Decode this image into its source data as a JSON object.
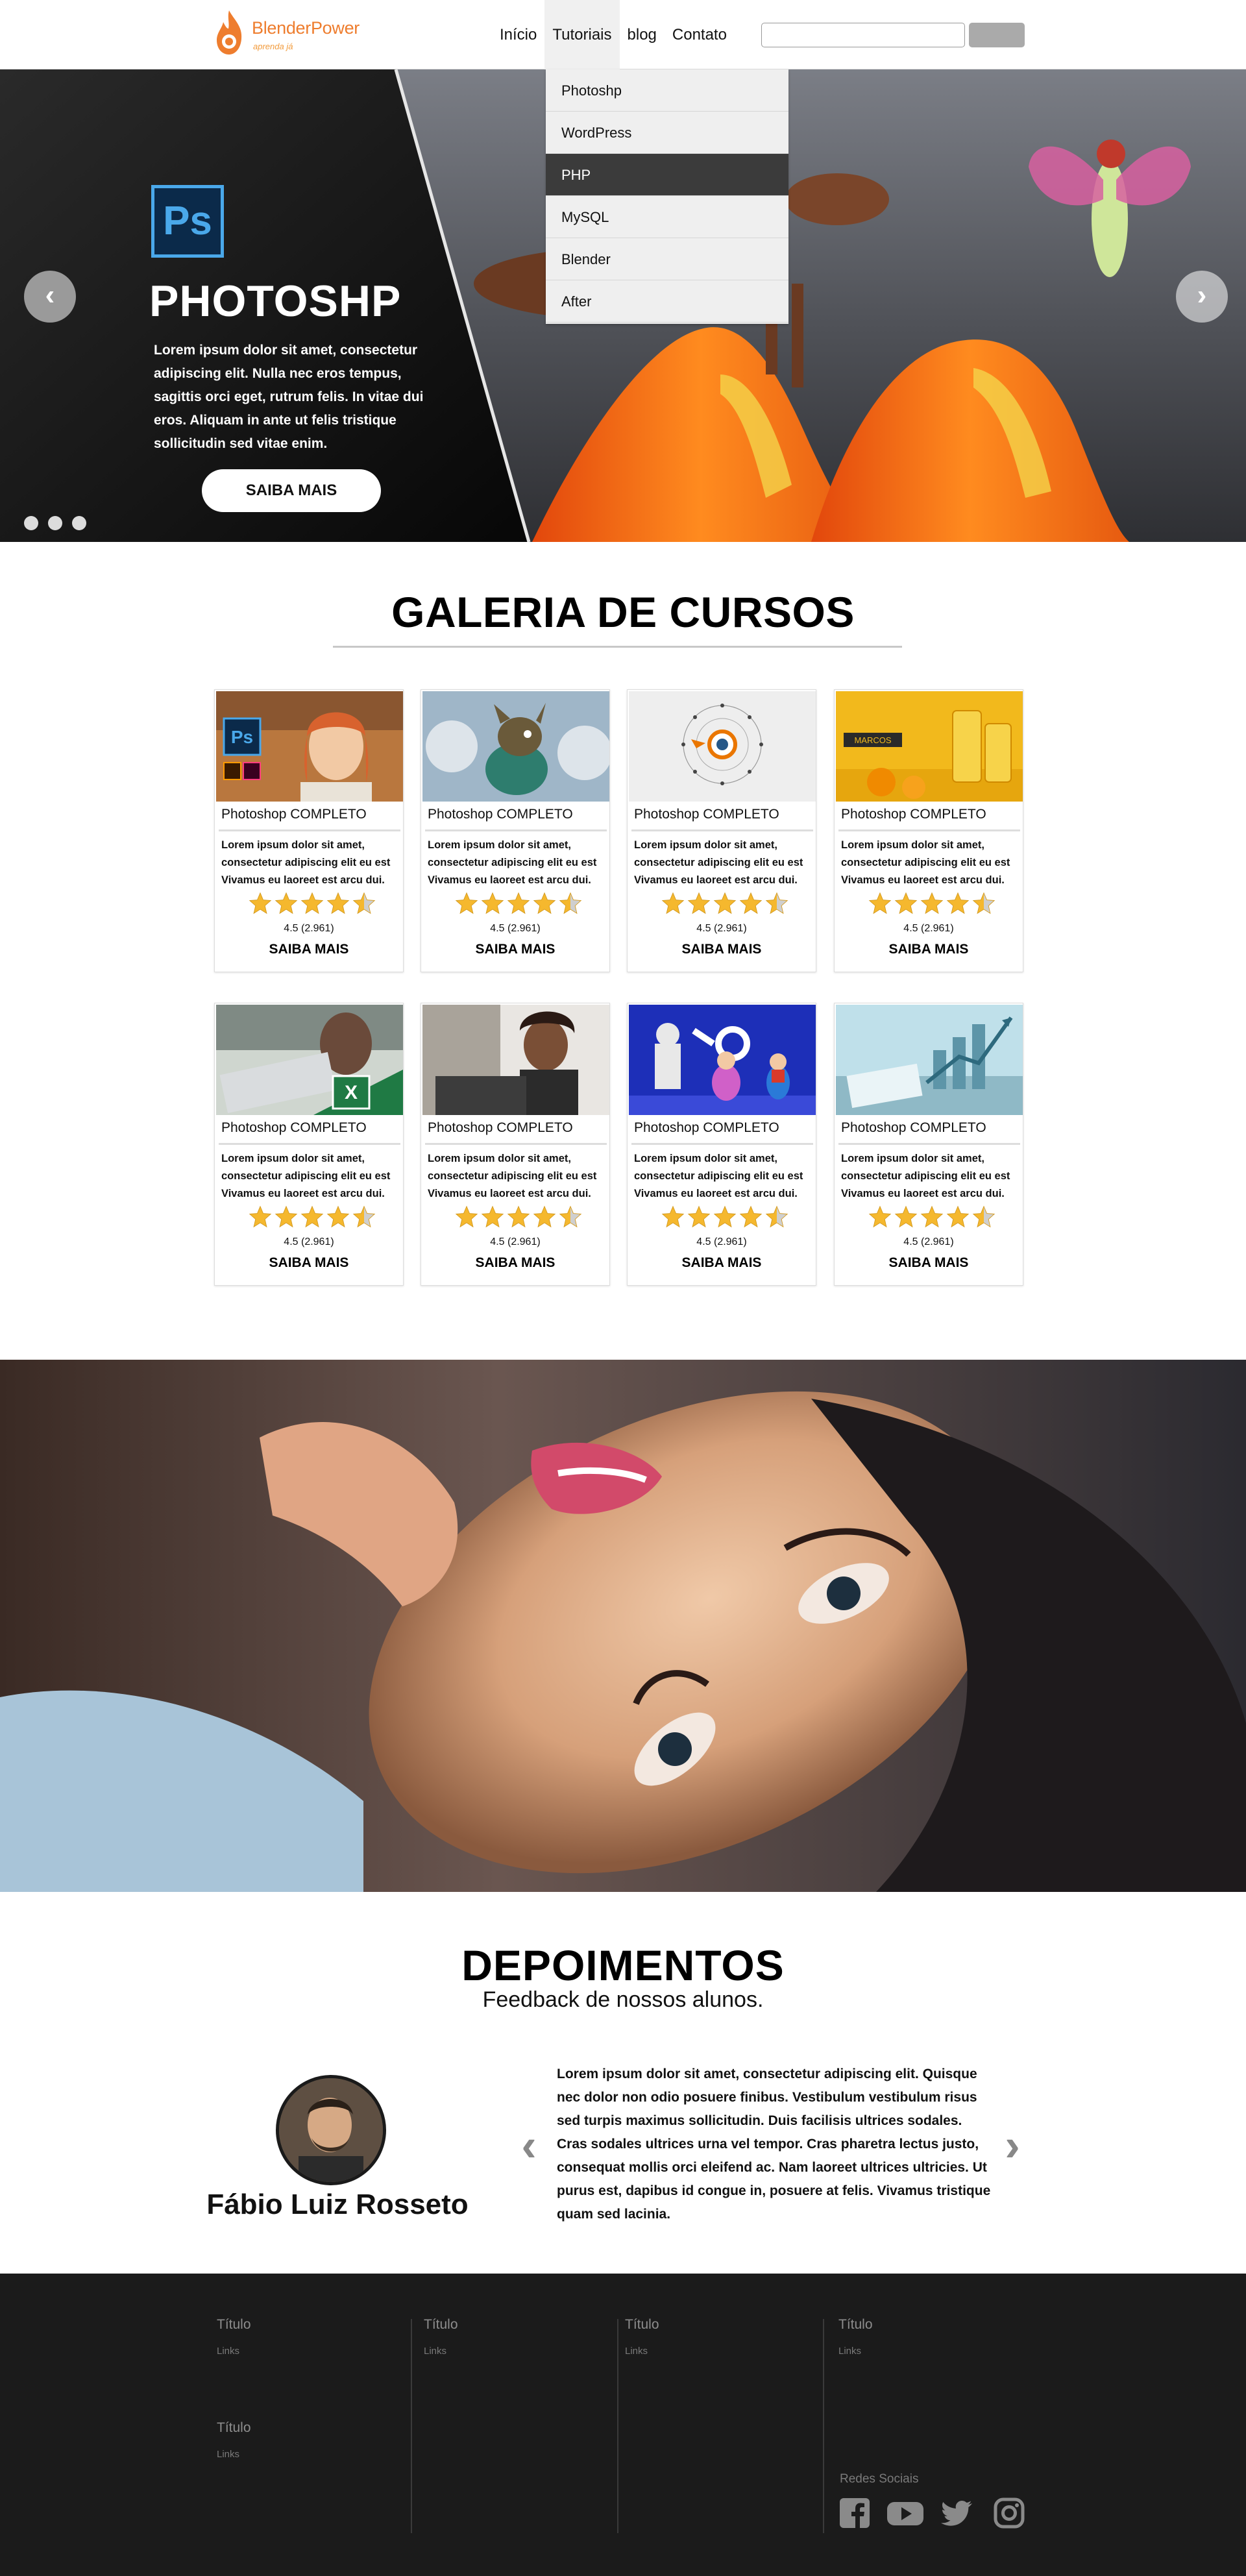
{
  "header": {
    "logo_name": "BlenderPower",
    "logo_tagline": "aprenda já",
    "nav": [
      "Início",
      "Tutoriais",
      "blog",
      "Contato"
    ],
    "search_placeholder": ""
  },
  "dropdown": {
    "items": [
      "Photoshp",
      "WordPress",
      "PHP",
      "MySQL",
      "Blender",
      "After"
    ],
    "highlighted": "PHP"
  },
  "hero": {
    "logo_text": "Ps",
    "title": "PHOTOSHP",
    "text": "Lorem ipsum dolor sit amet, consectetur adipiscing elit. Nulla nec eros tempus, sagittis orci eget, rutrum felis. In vitae dui eros. Aliquam in ante ut felis tristique sollicitudin sed vitae enim.",
    "cta": "SAIBA MAIS",
    "arrow_left": "‹",
    "arrow_right": "›",
    "slide_count": 3
  },
  "gallery": {
    "title": "GALERIA DE CURSOS",
    "cards": [
      {
        "title": "Photoshop COMPLETO",
        "desc": "Lorem ipsum dolor sit amet, consectetur adipiscing elit eu est Vivamus eu laoreet est arcu dui.",
        "rating": "4.5 (2.961)",
        "link": "SAIBA MAIS",
        "stars": 4.5,
        "image": "photoshop-woman"
      },
      {
        "title": "Photoshop COMPLETO",
        "desc": "Lorem ipsum dolor sit amet, consectetur adipiscing elit eu est Vivamus eu laoreet est arcu dui.",
        "rating": "4.5 (2.961)",
        "link": "SAIBA MAIS",
        "stars": 4.5,
        "image": "3d-creature"
      },
      {
        "title": "Photoshop COMPLETO",
        "desc": "Lorem ipsum dolor sit amet, consectetur adipiscing elit eu est Vivamus eu laoreet est arcu dui.",
        "rating": "4.5 (2.961)",
        "link": "SAIBA MAIS",
        "stars": 4.5,
        "image": "blender-logo"
      },
      {
        "title": "Photoshop COMPLETO",
        "desc": "Lorem ipsum dolor sit amet, consectetur adipiscing elit eu est Vivamus eu laoreet est arcu dui.",
        "rating": "4.5 (2.961)",
        "link": "SAIBA MAIS",
        "stars": 4.5,
        "image": "orange-juice-ad"
      },
      {
        "title": "Photoshop COMPLETO",
        "desc": "Lorem ipsum dolor sit amet, consectetur adipiscing elit eu est Vivamus eu laoreet est arcu dui.",
        "rating": "4.5 (2.961)",
        "link": "SAIBA MAIS",
        "stars": 4.5,
        "image": "excel-laptop"
      },
      {
        "title": "Photoshop COMPLETO",
        "desc": "Lorem ipsum dolor sit amet, consectetur adipiscing elit eu est Vivamus eu laoreet est arcu dui.",
        "rating": "4.5 (2.961)",
        "link": "SAIBA MAIS",
        "stars": 4.5,
        "image": "woman-laptop"
      },
      {
        "title": "Photoshop COMPLETO",
        "desc": "Lorem ipsum dolor sit amet, consectetur adipiscing elit eu est Vivamus eu laoreet est arcu dui.",
        "rating": "4.5 (2.961)",
        "link": "SAIBA MAIS",
        "stars": 4.5,
        "image": "blender-characters"
      },
      {
        "title": "Photoshop COMPLETO",
        "desc": "Lorem ipsum dolor sit amet, consectetur adipiscing elit eu est Vivamus eu laoreet est arcu dui.",
        "rating": "4.5 (2.961)",
        "link": "SAIBA MAIS",
        "stars": 4.5,
        "image": "business-chart"
      }
    ]
  },
  "testimonials": {
    "title": "DEPOIMENTOS",
    "subtitle": "Feedback de nossos alunos.",
    "author": "Fábio Luiz Rosseto",
    "text": "Lorem ipsum dolor sit amet, consectetur adipiscing elit. Quisque nec dolor non odio posuere finibus. Vestibulum vestibulum risus sed turpis maximus sollicitudin. Duis facilisis ultrices sodales. Cras sodales ultrices urna vel tempor. Cras pharetra lectus justo, consequat mollis orci eleifend ac. Nam laoreet ultrices ultricies. Ut purus est, dapibus id congue in, posuere at felis. Vivamus tristique quam sed lacinia.",
    "arrow_left": "‹",
    "arrow_right": "›"
  },
  "footer": {
    "columns": [
      {
        "heading": "Título",
        "link": "Links"
      },
      {
        "heading": "Título",
        "link": "Links"
      },
      {
        "heading": "Título",
        "link": "Links"
      },
      {
        "heading": "Título",
        "link": "Links"
      },
      {
        "heading": "Título",
        "link": "Links"
      }
    ],
    "social_label": "Redes Sociais",
    "social_icons": [
      "facebook-icon",
      "youtube-icon",
      "twitter-icon",
      "instagram-icon"
    ]
  },
  "colors": {
    "brand_orange": "#ee7d2e",
    "footer_bg": "#1b1b1b",
    "dropdown_highlight": "#3b3b3b",
    "star_gold": "#f5b82e"
  }
}
